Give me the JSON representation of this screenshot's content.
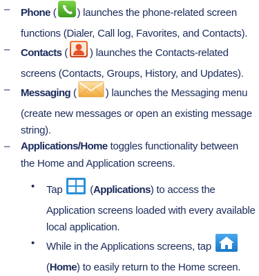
{
  "items": [
    {
      "dash": "–",
      "title": "Phone",
      "open_paren": "(",
      "icon": "phone-icon",
      "text_after": ") launches the phone-related screen functions (Dialer, Call log, Favorites, and Contacts).",
      "icon_color": "#5cb82e"
    },
    {
      "dash": "–",
      "title": "Contacts",
      "open_paren": "(",
      "icon": "contacts-icon",
      "text_after": ") launches the Contacts-related screens (Contacts, Groups, History, and Updates).",
      "icon_color": "#e2542a"
    },
    {
      "dash": "–",
      "title": "Messaging",
      "open_paren": "(",
      "icon": "envelope-icon",
      "text_after": ") launches the Messaging menu (create new messages or open an existing message string).",
      "icon_color": "#f4b84a"
    },
    {
      "dash": "–",
      "title": "Applications/Home",
      "text_after": " toggles functionality between the Home and Application screens."
    }
  ],
  "subitems": [
    {
      "bullet": "•",
      "text_before": "Tap",
      "icon": "applications-grid-icon",
      "icon_color": "#2a8fd8",
      "open_paren": "(",
      "bold_text": "Applications",
      "text_after": ") to access the Application screens loaded with every available local application."
    },
    {
      "bullet": "•",
      "text_before": "While in the Applications screens, tap",
      "icon": "home-icon",
      "icon_color": "#2a8fd8",
      "open_paren": "(",
      "bold_text": "Home",
      "text_after": ") to easily return to the Home screen."
    }
  ]
}
